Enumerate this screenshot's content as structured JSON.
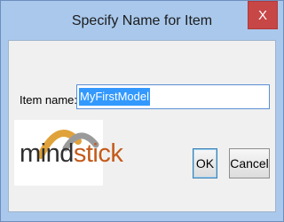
{
  "window": {
    "title": "Specify Name for Item",
    "close_label": "X"
  },
  "form": {
    "item_name_label": "Item name:",
    "item_name_value": "MyFirstModel"
  },
  "logo": {
    "text_part1": "mind",
    "text_part2": "stick",
    "colors": {
      "mind": "#2f2f2f",
      "stick": "#c45a1a",
      "arc_orange": "#e0a23a",
      "arc_gray": "#9a9a9a"
    }
  },
  "buttons": {
    "ok_label": "OK",
    "cancel_label": "Cancel"
  },
  "colors": {
    "frame": "#a9c8ec",
    "close_button": "#c74646",
    "selection": "#3399ff"
  }
}
